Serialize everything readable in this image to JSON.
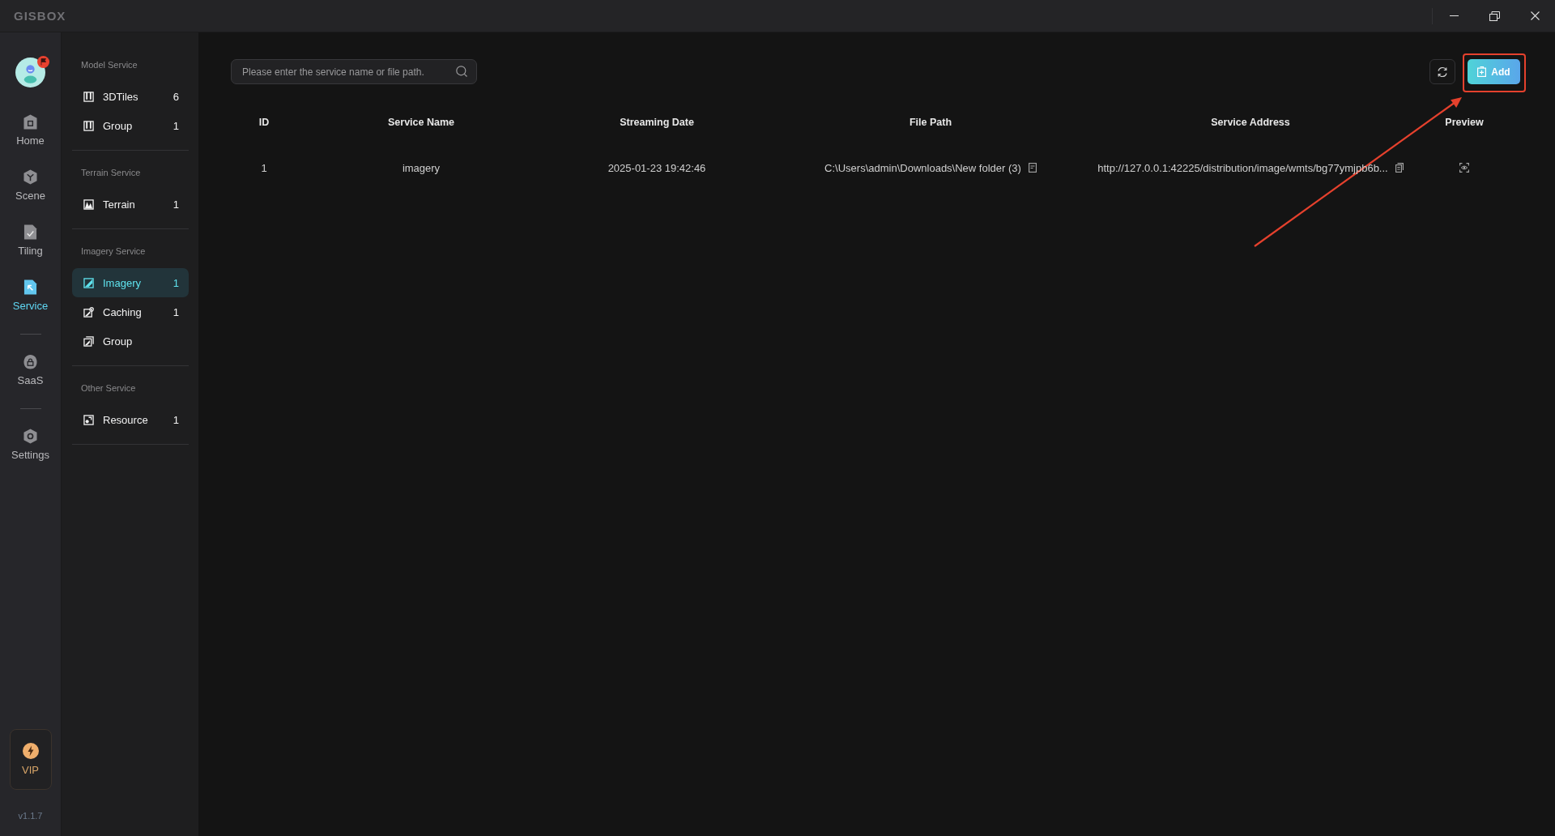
{
  "window": {
    "logo": "GISBOX"
  },
  "nav": {
    "avatar": {
      "notification": true
    },
    "groups": [
      {
        "items": [
          {
            "label": "Home",
            "kind": "home",
            "selected": false
          },
          {
            "label": "Scene",
            "kind": "scene",
            "selected": false
          },
          {
            "label": "Tiling",
            "kind": "tiling",
            "selected": false
          },
          {
            "label": "Service",
            "kind": "service",
            "selected": true
          }
        ]
      },
      {
        "items": [
          {
            "label": "SaaS",
            "kind": "saas",
            "selected": false
          }
        ]
      },
      {
        "items": [
          {
            "label": "Settings",
            "kind": "settings",
            "selected": false
          }
        ]
      }
    ],
    "vip": {
      "label": "VIP"
    },
    "version": "v1.1.7"
  },
  "sidebar": {
    "sections": [
      {
        "title": "Model Service",
        "items": [
          {
            "label": "3DTiles",
            "kind": "model",
            "count": "6",
            "selected": false
          },
          {
            "label": "Group",
            "kind": "model",
            "count": "1",
            "selected": false
          }
        ]
      },
      {
        "title": "Terrain Service",
        "items": [
          {
            "label": "Terrain",
            "kind": "terrain",
            "count": "1",
            "selected": false
          }
        ]
      },
      {
        "title": "Imagery Service",
        "items": [
          {
            "label": "Imagery",
            "kind": "imagery",
            "count": "1",
            "selected": true
          },
          {
            "label": "Caching",
            "kind": "caching",
            "count": "1",
            "selected": false
          },
          {
            "label": "Group",
            "kind": "imagery-group",
            "selected": false
          }
        ]
      },
      {
        "title": "Other Service",
        "items": [
          {
            "label": "Resource",
            "kind": "resource",
            "count": "1",
            "selected": false
          }
        ]
      }
    ]
  },
  "toolbar": {
    "search": {
      "placeholder": "Please enter the service name or file path."
    },
    "add_button": {
      "label": "Add"
    }
  },
  "table": {
    "columns": [
      "ID",
      "Service Name",
      "Streaming Date",
      "File Path",
      "Service Address",
      "Preview"
    ],
    "rows": [
      {
        "id": "1",
        "service_name": "imagery",
        "streaming_date": "2025-01-23 19:42:46",
        "file_path": "C:\\Users\\admin\\Downloads\\New folder (3)",
        "service_address": "http://127.0.0.1:42225/distribution/image/wmts/bg77ymjpb6b..."
      }
    ]
  }
}
